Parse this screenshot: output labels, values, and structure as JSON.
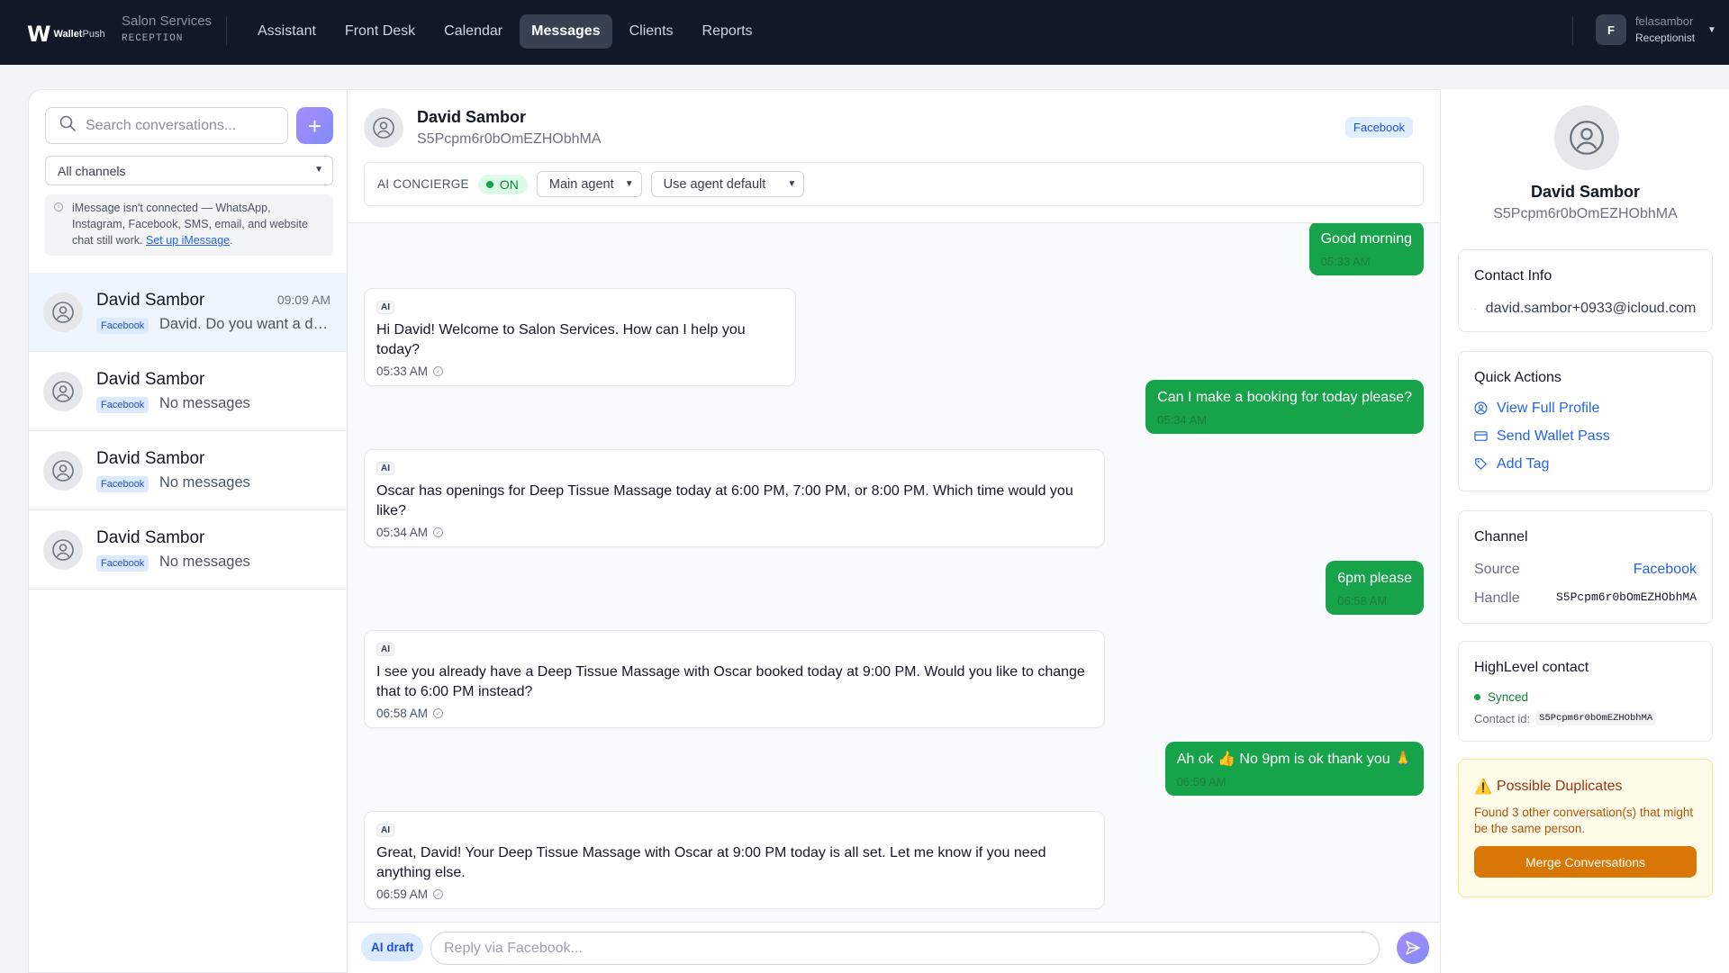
{
  "topbar": {
    "logo_mark": "W",
    "logo_brand_bold": "Wallet",
    "logo_brand_light": "Push",
    "org_name": "Salon Services",
    "org_role": "RECEPTION",
    "nav": [
      {
        "label": "Assistant",
        "active": false
      },
      {
        "label": "Front Desk",
        "active": false
      },
      {
        "label": "Calendar",
        "active": false
      },
      {
        "label": "Messages",
        "active": true
      },
      {
        "label": "Clients",
        "active": false
      },
      {
        "label": "Reports",
        "active": false
      }
    ],
    "user_initial": "F",
    "user_name": "felasambor",
    "user_role": "Receptionist"
  },
  "sidebar": {
    "search_placeholder": "Search conversations...",
    "add_label": "+",
    "channel_filter": "All channels",
    "notice_text": "iMessage isn't connected — WhatsApp, Instagram, Facebook, SMS, email, and website chat still work.",
    "notice_link": "Set up iMessage",
    "notice_end": ".",
    "conversations": [
      {
        "name": "David Sambor",
        "time": "09:09 AM",
        "channel": "Facebook",
        "preview": "David. Do you want a dee..."
      },
      {
        "name": "David Sambor",
        "time": "",
        "channel": "Facebook",
        "preview": "No messages"
      },
      {
        "name": "David Sambor",
        "time": "",
        "channel": "Facebook",
        "preview": "No messages"
      },
      {
        "name": "David Sambor",
        "time": "",
        "channel": "Facebook",
        "preview": "No messages"
      }
    ]
  },
  "chat": {
    "name": "David Sambor",
    "handle": "S5Pcpm6r0bOmEZHObhMA",
    "channel": "Facebook",
    "concierge_label": "AI CONCIERGE",
    "concierge_state": "ON",
    "agent_select": "Main agent",
    "agent_mode_select": "Use agent default",
    "ai_badge": "AI",
    "messages": [
      {
        "dir": "out",
        "text": "Good morning",
        "time": "05:33 AM"
      },
      {
        "dir": "in",
        "text": "Hi David! Welcome to Salon Services. How can I help you today?",
        "time": "05:33 AM"
      },
      {
        "dir": "out",
        "text": "Can I make a booking for today please?",
        "time": "05:34 AM"
      },
      {
        "dir": "in",
        "text": "Oscar has openings for Deep Tissue Massage today at 6:00 PM, 7:00 PM, or 8:00 PM. Which time would you like?",
        "time": "05:34 AM"
      },
      {
        "dir": "out",
        "text": "6pm please",
        "time": "06:58 AM"
      },
      {
        "dir": "in",
        "text": "I see you already have a Deep Tissue Massage with Oscar booked today at 9:00 PM. Would you like to change that to 6:00 PM instead?",
        "time": "06:58 AM"
      },
      {
        "dir": "out",
        "text": "Ah ok 👍 No 9pm is ok thank you 🙏",
        "time": "06:59 AM"
      },
      {
        "dir": "in",
        "text": "Great, David! Your Deep Tissue Massage with Oscar at 9:00 PM today is all set. Let me know if you need anything else.",
        "time": "06:59 AM"
      }
    ],
    "ai_draft_label": "AI draft",
    "reply_placeholder": "Reply via Facebook..."
  },
  "profile": {
    "name": "David Sambor",
    "handle": "S5Pcpm6r0bOmEZHObhMA",
    "contact_title": "Contact Info",
    "email": "david.sambor+0933@icloud.com",
    "qa_title": "Quick Actions",
    "qa_view": "View Full Profile",
    "qa_wallet": "Send Wallet Pass",
    "qa_tag": "Add Tag",
    "channel_title": "Channel",
    "source_label": "Source",
    "source_value": "Facebook",
    "handle_label": "Handle",
    "handle_value": "S5Pcpm6r0bOmEZHObhMA",
    "hl_title": "HighLevel contact",
    "hl_status": "Synced",
    "hl_contact_label": "Contact id:",
    "hl_contact_id": "S5Pcpm6r0bOmEZHObhMA",
    "dup_icon": "⚠️",
    "dup_title": "Possible Duplicates",
    "dup_desc": "Found 3 other conversation(s) that might be the same person.",
    "dup_button": "Merge Conversations"
  }
}
